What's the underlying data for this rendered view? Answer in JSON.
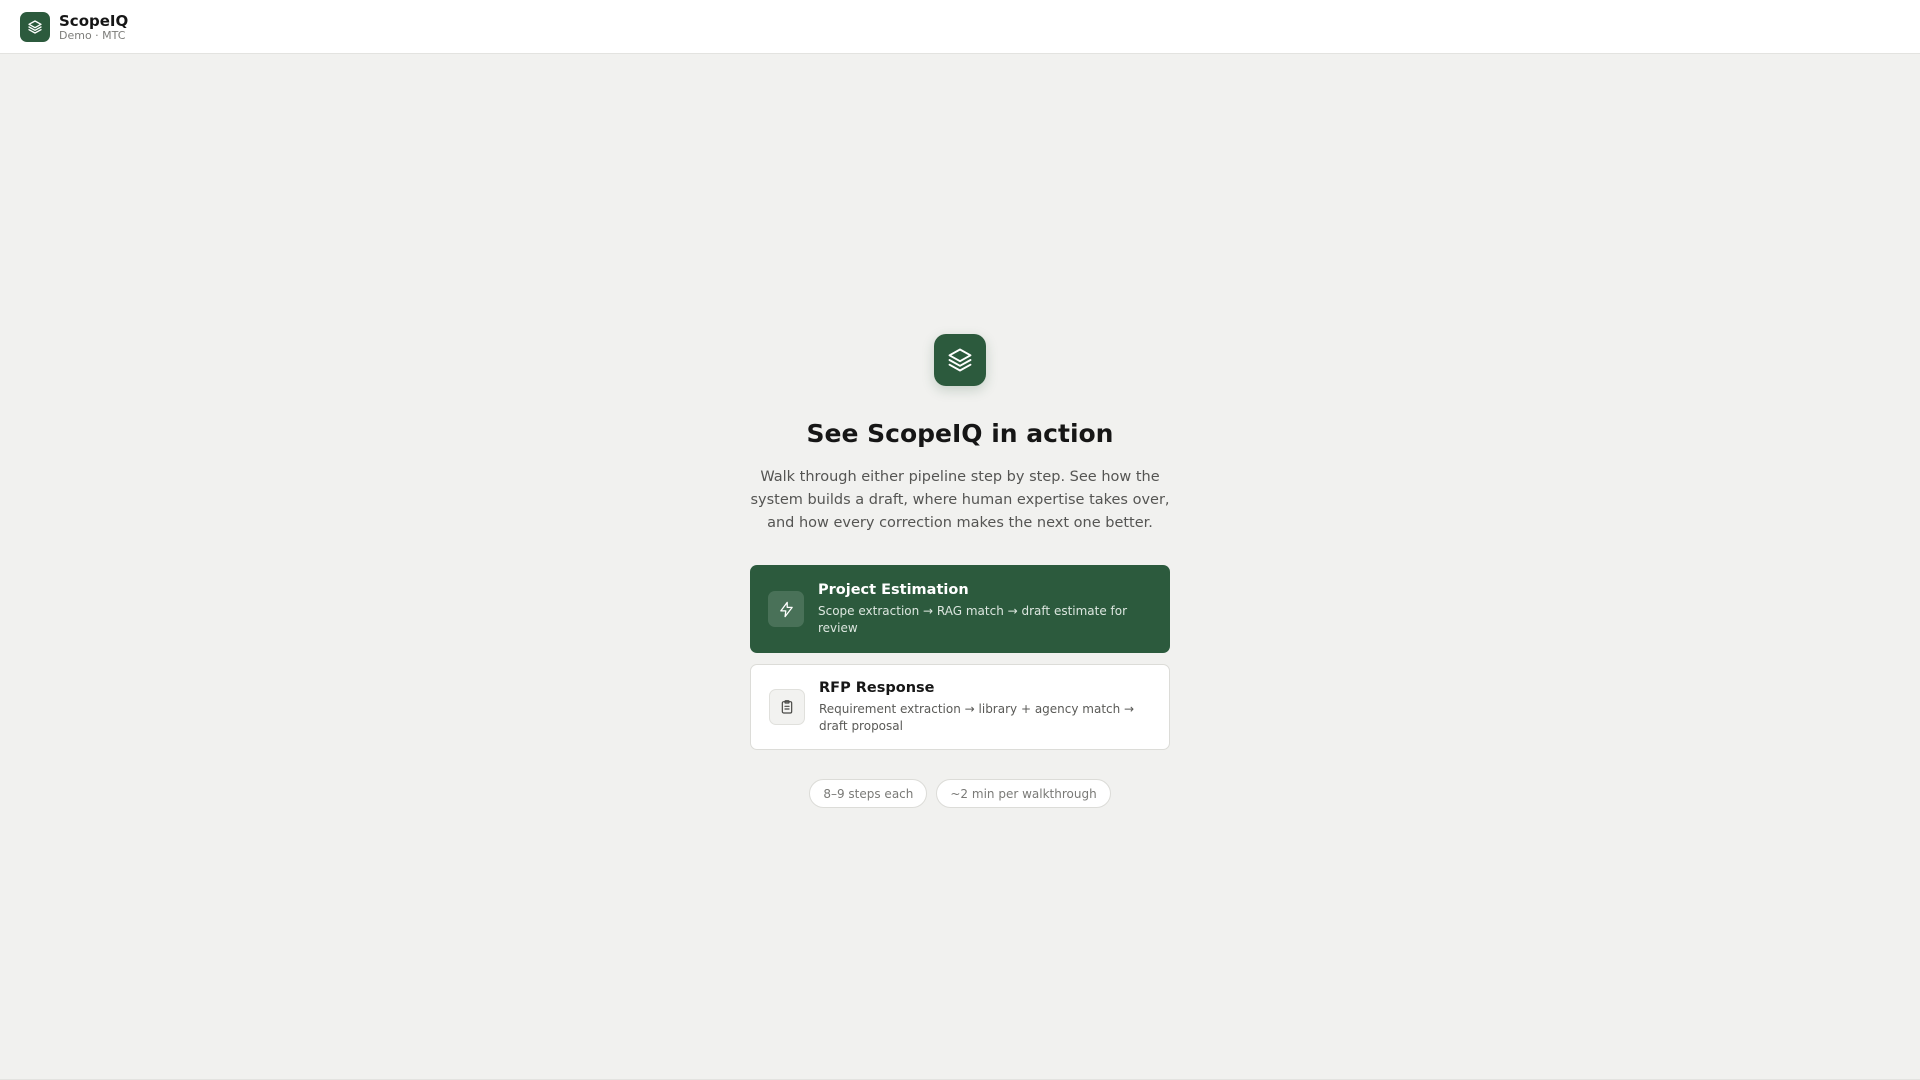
{
  "header": {
    "brand_name": "ScopeIQ",
    "brand_sub": "Demo · MTC",
    "logo_icon": "layers-icon"
  },
  "hero": {
    "icon": "layers-icon",
    "heading": "See ScopeIQ in action",
    "description": "Walk through either pipeline step by step. See how the system builds a draft, where human expertise takes over, and how every correction makes the next one better."
  },
  "cards": [
    {
      "icon": "lightning-icon",
      "title": "Project Estimation",
      "description": "Scope extraction → RAG match → draft estimate for review",
      "selected": true
    },
    {
      "icon": "clipboard-icon",
      "title": "RFP Response",
      "description": "Requirement extraction → library + agency match → draft proposal",
      "selected": false
    }
  ],
  "pills": [
    "8–9 steps each",
    "~2 min per walkthrough"
  ],
  "colors": {
    "accent": "#2c5a3d",
    "background": "#f1f1ef",
    "surface": "#ffffff"
  }
}
